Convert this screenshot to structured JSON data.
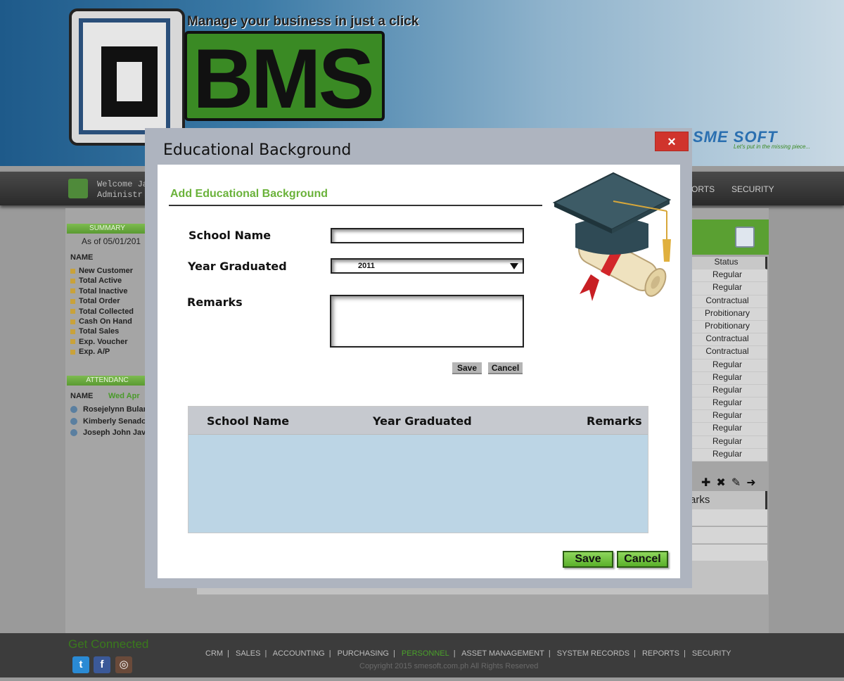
{
  "header": {
    "tagline": "Manage your business in just a click",
    "logo_text": "BMS",
    "partner_logo": "SME SOFT",
    "partner_tagline": "Let's put in the missing piece..."
  },
  "navbar": {
    "welcome": "Welcome Ja",
    "role": "Administr",
    "items": [
      "ORTS",
      "SECURITY"
    ]
  },
  "summary": {
    "title": "SUMMARY",
    "as_of": "As of 05/01/201",
    "name_header": "NAME",
    "items": [
      "New Customer",
      "Total Active",
      "Total Inactive",
      "Total Order",
      "Total Collected",
      "Cash On Hand",
      "Total Sales",
      "Exp. Voucher",
      "Exp. A/P"
    ]
  },
  "attendance": {
    "title": "ATTENDANC",
    "name_header": "NAME",
    "date": "Wed Apr",
    "people": [
      "Rosejelynn Bular",
      "Kimberly Senado",
      "Joseph John Javi"
    ]
  },
  "status_table": {
    "header": "Status",
    "rows": [
      "Regular",
      "Regular",
      "Contractual",
      "Probitionary",
      "Probitionary",
      "Contractual",
      "Contractual",
      "Regular",
      "Regular",
      "Regular",
      "Regular",
      "Regular",
      "Regular",
      "Regular",
      "Regular"
    ]
  },
  "remarks_fragment": "arks",
  "modal": {
    "title": "Educational Background",
    "close_label": "×",
    "section_title": "Add Educational Background",
    "labels": {
      "school_name": "School Name",
      "year_graduated": "Year Graduated",
      "remarks": "Remarks"
    },
    "fields": {
      "school_name_value": "",
      "year_selected": "2011",
      "remarks_value": ""
    },
    "small_save": "Save",
    "small_cancel": "Cancel",
    "grid_headers": [
      "School Name",
      "Year Graduated",
      "Remarks"
    ],
    "save": "Save",
    "cancel": "Cancel"
  },
  "footer": {
    "get_connected": "Get Connected",
    "links": [
      "CRM",
      "SALES",
      "ACCOUNTING",
      "PURCHASING",
      "PERSONNEL",
      "ASSET MANAGEMENT",
      "SYSTEM RECORDS",
      "REPORTS",
      "SECURITY"
    ],
    "active_link": "PERSONNEL",
    "copyright": "Copyright 2015   smesoft.com.ph   All Rights Reserved"
  },
  "colors": {
    "accent_green": "#6ab23a",
    "close_red": "#d0342c",
    "grid_blue": "#bcd5e5"
  }
}
